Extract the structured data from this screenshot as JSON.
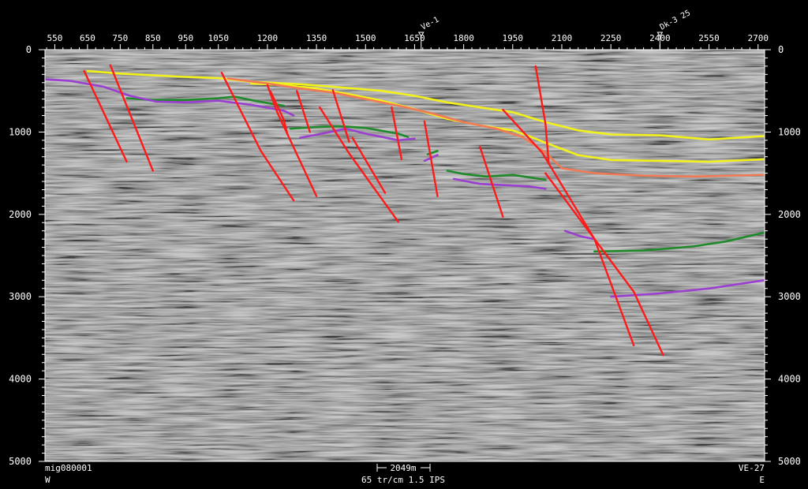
{
  "section": {
    "id": "mig080001",
    "line_name": "VE-27",
    "west_label": "W",
    "east_label": "E",
    "scale_bar": "2049m",
    "display_params": "65 tr/cm 1.5 IPS"
  },
  "wells": [
    {
      "name": "Ve-1",
      "trace": 1670
    },
    {
      "name": "Dk-3 25",
      "trace": 2400
    }
  ],
  "x_axis": {
    "range": [
      520,
      2720
    ],
    "ticks": [
      550,
      650,
      750,
      850,
      950,
      1050,
      1200,
      1350,
      1500,
      1650,
      1800,
      1950,
      2100,
      2250,
      2400,
      2550,
      2700
    ]
  },
  "y_axis": {
    "range": [
      0,
      5000
    ],
    "ticks": [
      0,
      1000,
      2000,
      3000,
      4000,
      5000
    ]
  },
  "colors": {
    "background": "#000000",
    "seismic_base": "#8c8c8c",
    "fault": "#ff1a1a",
    "yellow_horizon": "#f2f21a",
    "orange_horizon": "#f07a55",
    "green_horizon": "#1e8a2a",
    "purple_horizon": "#9a3fd0"
  },
  "horizons": [
    {
      "color": "yellow_horizon",
      "segments": [
        [
          [
            650,
            260
          ],
          [
            750,
            290
          ],
          [
            850,
            310
          ],
          [
            950,
            330
          ],
          [
            1050,
            345
          ],
          [
            1150,
            390
          ],
          [
            1300,
            420
          ],
          [
            1400,
            450
          ],
          [
            1550,
            500
          ],
          [
            1650,
            560
          ],
          [
            1750,
            640
          ],
          [
            1850,
            700
          ],
          [
            1950,
            760
          ],
          [
            2050,
            880
          ],
          [
            2150,
            980
          ],
          [
            2250,
            1030
          ],
          [
            2400,
            1040
          ],
          [
            2550,
            1090
          ],
          [
            2720,
            1050
          ]
        ]
      ]
    },
    {
      "color": "yellow_horizon",
      "segments": [
        [
          [
            1150,
            410
          ],
          [
            1250,
            430
          ],
          [
            1350,
            470
          ],
          [
            1450,
            540
          ],
          [
            1550,
            620
          ],
          [
            1650,
            720
          ],
          [
            1750,
            840
          ],
          [
            1850,
            920
          ],
          [
            1950,
            980
          ],
          [
            2000,
            1050
          ],
          [
            2050,
            1130
          ],
          [
            2150,
            1280
          ],
          [
            2250,
            1340
          ],
          [
            2400,
            1350
          ],
          [
            2550,
            1360
          ],
          [
            2720,
            1330
          ]
        ]
      ]
    },
    {
      "color": "orange_horizon",
      "segments": [
        [
          [
            1080,
            350
          ],
          [
            1200,
            410
          ],
          [
            1300,
            470
          ],
          [
            1400,
            520
          ],
          [
            1500,
            600
          ],
          [
            1600,
            680
          ],
          [
            1700,
            770
          ],
          [
            1800,
            880
          ],
          [
            1900,
            960
          ],
          [
            1980,
            1060
          ],
          [
            2050,
            1250
          ],
          [
            2100,
            1440
          ],
          [
            2200,
            1500
          ],
          [
            2350,
            1530
          ],
          [
            2500,
            1540
          ],
          [
            2720,
            1520
          ]
        ]
      ]
    },
    {
      "color": "green_horizon",
      "segments": [
        [
          [
            770,
            590
          ],
          [
            850,
            610
          ],
          [
            950,
            610
          ],
          [
            1050,
            590
          ],
          [
            1100,
            570
          ],
          [
            1160,
            620
          ],
          [
            1250,
            680
          ]
        ],
        [
          [
            1270,
            960
          ],
          [
            1350,
            940
          ],
          [
            1420,
            930
          ],
          [
            1500,
            950
          ],
          [
            1600,
            1020
          ],
          [
            1630,
            1060
          ]
        ],
        [
          [
            1690,
            1270
          ],
          [
            1720,
            1230
          ]
        ],
        [
          [
            1750,
            1470
          ],
          [
            1800,
            1510
          ],
          [
            1870,
            1540
          ],
          [
            1950,
            1520
          ],
          [
            2000,
            1550
          ],
          [
            2050,
            1580
          ]
        ],
        [
          [
            2200,
            2450
          ],
          [
            2350,
            2440
          ],
          [
            2500,
            2390
          ],
          [
            2600,
            2330
          ],
          [
            2720,
            2220
          ]
        ]
      ]
    },
    {
      "color": "purple_horizon",
      "segments": [
        [
          [
            520,
            360
          ],
          [
            600,
            380
          ],
          [
            700,
            450
          ],
          [
            780,
            560
          ],
          [
            860,
            630
          ],
          [
            950,
            640
          ],
          [
            1050,
            620
          ],
          [
            1150,
            670
          ],
          [
            1250,
            740
          ],
          [
            1280,
            800
          ]
        ],
        [
          [
            1300,
            1070
          ],
          [
            1380,
            1010
          ],
          [
            1440,
            960
          ],
          [
            1500,
            1020
          ],
          [
            1600,
            1100
          ],
          [
            1650,
            1080
          ]
        ],
        [
          [
            1680,
            1350
          ],
          [
            1720,
            1280
          ]
        ],
        [
          [
            1770,
            1570
          ],
          [
            1850,
            1630
          ],
          [
            1950,
            1650
          ],
          [
            2000,
            1660
          ],
          [
            2050,
            1690
          ]
        ],
        [
          [
            2110,
            2200
          ],
          [
            2160,
            2270
          ],
          [
            2200,
            2300
          ]
        ],
        [
          [
            2250,
            3000
          ],
          [
            2400,
            2960
          ],
          [
            2550,
            2900
          ],
          [
            2720,
            2800
          ]
        ]
      ]
    }
  ],
  "faults": [
    [
      [
        640,
        260
      ],
      [
        770,
        1360
      ]
    ],
    [
      [
        720,
        190
      ],
      [
        850,
        1470
      ]
    ],
    [
      [
        1060,
        280
      ],
      [
        1180,
        1230
      ],
      [
        1280,
        1830
      ]
    ],
    [
      [
        1200,
        430
      ],
      [
        1230,
        760
      ],
      [
        1350,
        1780
      ]
    ],
    [
      [
        1210,
        510
      ],
      [
        1250,
        850
      ],
      [
        1260,
        1010
      ]
    ],
    [
      [
        1290,
        500
      ],
      [
        1330,
        1000
      ]
    ],
    [
      [
        1360,
        700
      ],
      [
        1450,
        1260
      ],
      [
        1600,
        2090
      ]
    ],
    [
      [
        1400,
        490
      ],
      [
        1450,
        1120
      ]
    ],
    [
      [
        1460,
        1070
      ],
      [
        1500,
        1340
      ],
      [
        1560,
        1740
      ]
    ],
    [
      [
        1580,
        700
      ],
      [
        1610,
        1330
      ]
    ],
    [
      [
        1680,
        870
      ],
      [
        1720,
        1780
      ]
    ],
    [
      [
        1850,
        1180
      ],
      [
        1920,
        2030
      ]
    ],
    [
      [
        1920,
        730
      ],
      [
        2040,
        1250
      ],
      [
        2200,
        2300
      ],
      [
        2320,
        3590
      ]
    ],
    [
      [
        2050,
        1500
      ],
      [
        2320,
        2940
      ],
      [
        2410,
        3710
      ]
    ],
    [
      [
        2020,
        200
      ],
      [
        2050,
        900
      ],
      [
        2060,
        1380
      ]
    ]
  ]
}
